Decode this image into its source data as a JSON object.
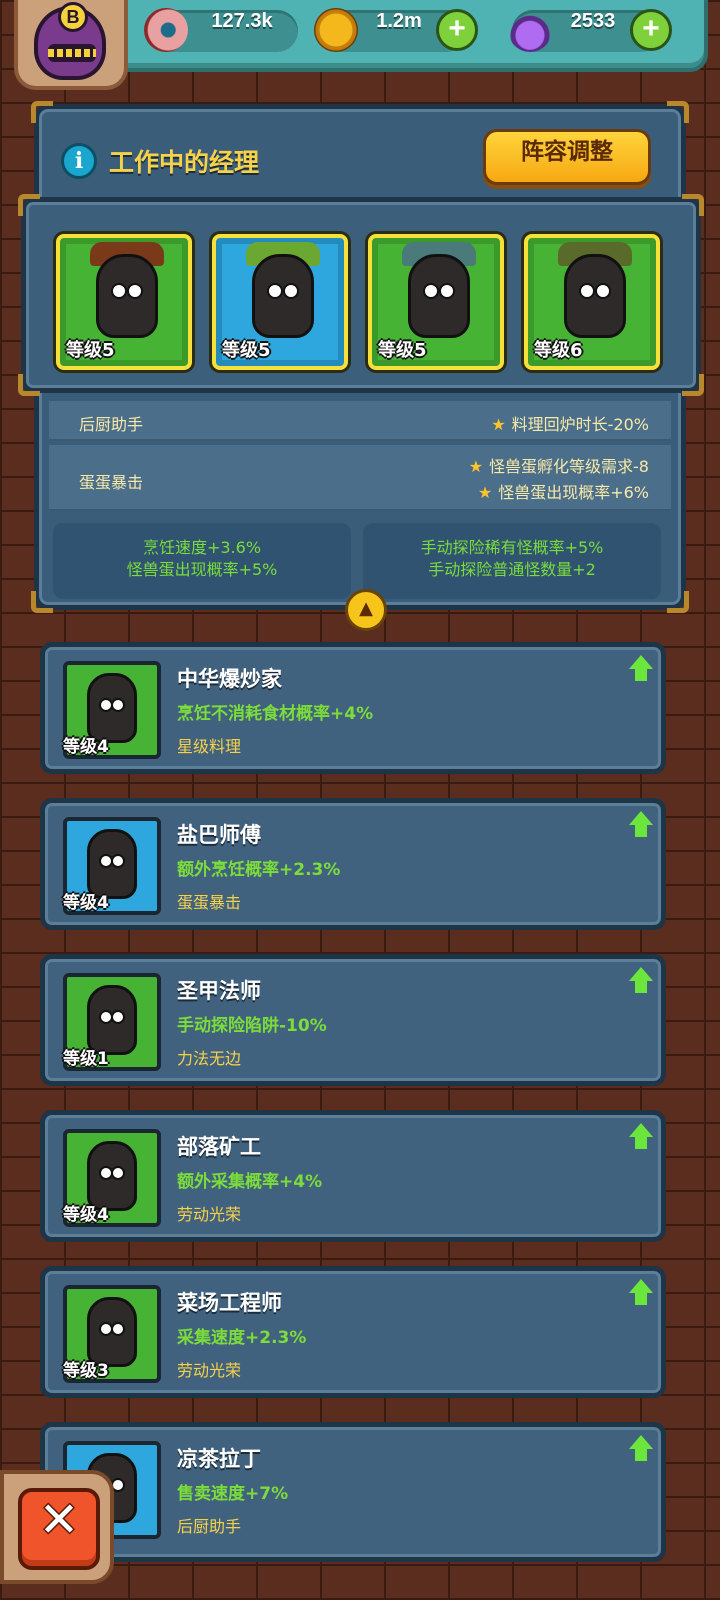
{
  "resources": {
    "eyes": "127.3k",
    "coins": "1.2m",
    "potions": "2533",
    "avatar_badge": "B"
  },
  "panel": {
    "title": "工作中的经理",
    "lineup_button": "阵容调整",
    "managers": [
      {
        "level": "等级5",
        "bg": "green"
      },
      {
        "level": "等级5",
        "bg": "blue"
      },
      {
        "level": "等级5",
        "bg": "green"
      },
      {
        "level": "等级6",
        "bg": "green"
      }
    ],
    "bonuses": [
      {
        "name": "后厨助手",
        "effects": [
          "料理回炉时长-20%"
        ]
      },
      {
        "name": "蛋蛋暴击",
        "effects": [
          "怪兽蛋孵化等级需求-8",
          "怪兽蛋出现概率+6%"
        ]
      }
    ],
    "totals_left": [
      "烹饪速度+3.6%",
      "怪兽蛋出现概率+5%"
    ],
    "totals_right": [
      "手动探险稀有怪概率+5%",
      "手动探险普通怪数量+2"
    ]
  },
  "list": [
    {
      "name": "中华爆炒家",
      "effect": "烹饪不消耗食材概率+4%",
      "skill": "星级料理",
      "level": "等级4",
      "bg": "green"
    },
    {
      "name": "盐巴师傅",
      "effect": "额外烹饪概率+2.3%",
      "skill": "蛋蛋暴击",
      "level": "等级4",
      "bg": "blue"
    },
    {
      "name": "圣甲法师",
      "effect": "手动探险陷阱-10%",
      "skill": "力法无边",
      "level": "等级1",
      "bg": "green"
    },
    {
      "name": "部落矿工",
      "effect": "额外采集概率+4%",
      "skill": "劳动光荣",
      "level": "等级4",
      "bg": "green"
    },
    {
      "name": "菜场工程师",
      "effect": "采集速度+2.3%",
      "skill": "劳动光荣",
      "level": "等级3",
      "bg": "green"
    },
    {
      "name": "凉茶拉丁",
      "effect": "售卖速度+7%",
      "skill": "后厨助手",
      "level": "",
      "bg": "blue"
    }
  ],
  "close_button": "✕",
  "colors": {
    "panel_bg": "#3a5d79",
    "gold_text": "#f6d24a",
    "green_text": "#7bdc3b",
    "card_green": "#46b334",
    "card_blue": "#2ea7df"
  }
}
